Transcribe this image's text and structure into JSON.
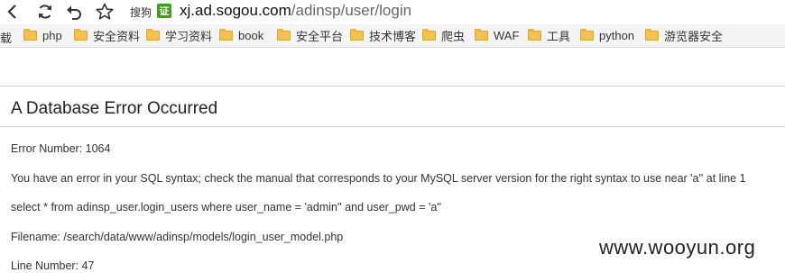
{
  "browser": {
    "search_engine_label": "搜狗",
    "cert_badge": "证",
    "address": {
      "host": "xj.ad.sogou.com",
      "path": "/adinsp/user/login"
    }
  },
  "bookmarks": {
    "leading_fragment": "载",
    "items": [
      {
        "label": "php"
      },
      {
        "label": "安全资料"
      },
      {
        "label": "学习资料"
      },
      {
        "label": "book"
      },
      {
        "label": "安全平台"
      },
      {
        "label": "技术博客"
      },
      {
        "label": "爬虫"
      },
      {
        "label": "WAF"
      },
      {
        "label": "工具"
      },
      {
        "label": "python"
      },
      {
        "label": "游览器安全"
      }
    ],
    "folder_color": "#f2c14e"
  },
  "error": {
    "title": "A Database Error Occurred",
    "error_number": "Error Number: 1064",
    "message": "You have an error in your SQL syntax; check the manual that corresponds to your MySQL server version for the right syntax to use near 'a'' at line 1",
    "query": "select * from adinsp_user.login_users where user_name = 'admin'' and user_pwd = 'a''",
    "filename": "Filename: /search/data/www/adinsp/models/login_user_model.php",
    "line_number": "Line Number: 47"
  },
  "watermark": "www.wooyun.org"
}
